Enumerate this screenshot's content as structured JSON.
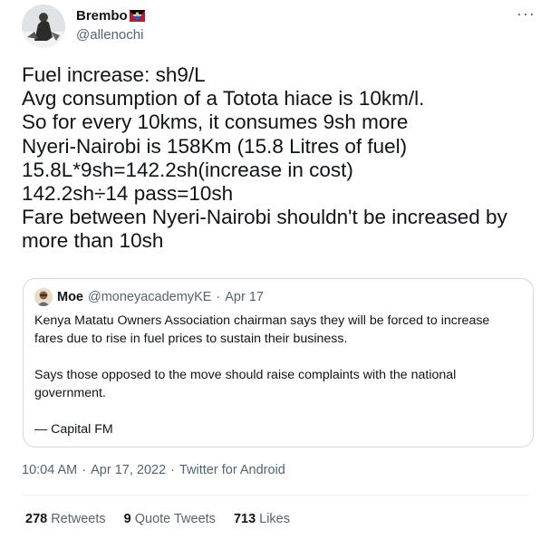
{
  "author": {
    "name": "Brembo",
    "handle": "@allenochi",
    "flag_icon": "antigua-and-barbuda-flag-icon"
  },
  "tweet": {
    "lines": [
      "Fuel increase: sh9/L",
      "Avg consumption of a Totota hiace is 10km/l.",
      "So for every 10kms, it consumes 9sh more",
      "Nyeri-Nairobi is 158Km (15.8 Litres of fuel)",
      "15.8L*9sh=142.2sh(increase in cost)",
      "142.2sh÷14 pass=10sh",
      "Fare between Nyeri-Nairobi shouldn't be increased by",
      "more than 10sh"
    ]
  },
  "quote": {
    "name": "Moe",
    "handle": "@moneyacademyKE",
    "separator": "·",
    "date": "Apr 17",
    "paragraphs": [
      "Kenya Matatu Owners Association chairman says they will be forced to increase",
      "fares due to rise in fuel prices to sustain their business.",
      "Says those opposed to the move should raise complaints with the national",
      "government.",
      "— Capital FM"
    ]
  },
  "meta": {
    "time": "10:04 AM",
    "date": "Apr 17, 2022",
    "source": "Twitter for Android",
    "separator": "·"
  },
  "stats": {
    "retweets_count": "278",
    "retweets_label": "Retweets",
    "quotes_count": "9",
    "quotes_label": "Quote Tweets",
    "likes_count": "713",
    "likes_label": "Likes"
  },
  "more_icon": "more-options-icon",
  "more_glyph": "···"
}
